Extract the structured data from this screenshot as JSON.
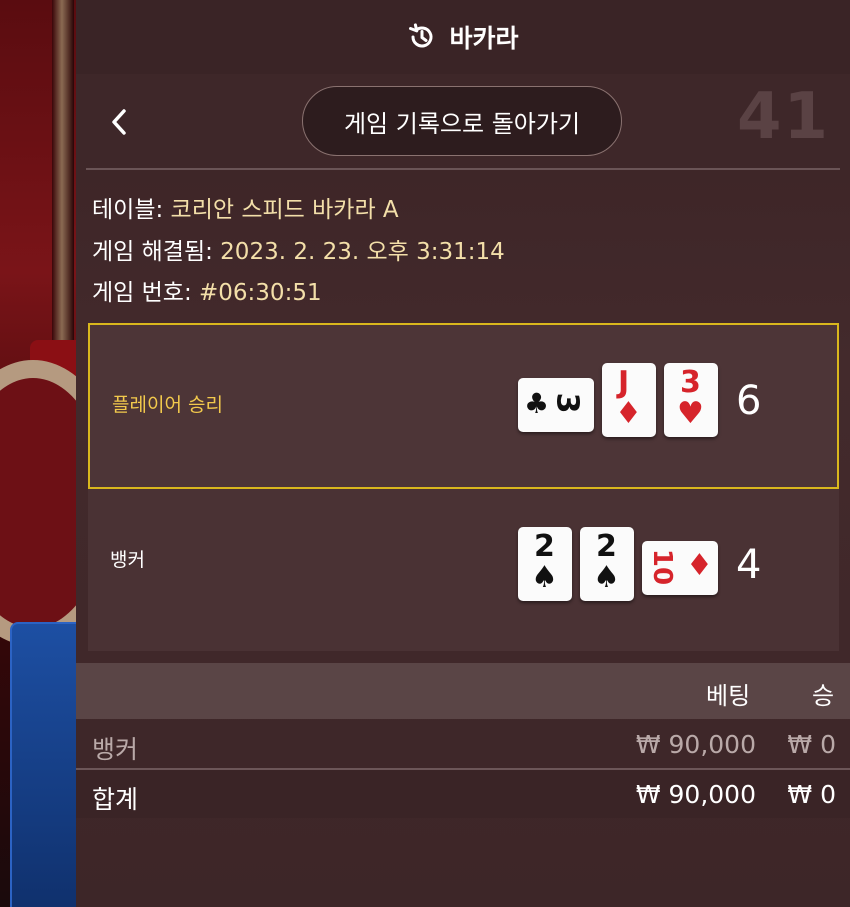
{
  "header": {
    "title": "바카라",
    "icon": "history-icon"
  },
  "nav": {
    "back_button_label": "게임 기록으로 돌아가기",
    "background_number": "41"
  },
  "info": {
    "table_label": "테이블: ",
    "table_value": "코리안 스피드 바카라 A",
    "resolved_label": "게임 해결됨: ",
    "resolved_value": "2023. 2. 23. 오후 3:31:14",
    "game_no_label": "게임 번호: ",
    "game_no_value": "#06:30:51"
  },
  "result": {
    "player": {
      "label": "플레이어 승리",
      "score": "6",
      "cards": [
        {
          "rank": "3",
          "suit": "♣",
          "color": "#111111",
          "orientation": "horizontal"
        },
        {
          "rank": "J",
          "suit": "♦",
          "color": "#d6242b",
          "orientation": "vertical"
        },
        {
          "rank": "3",
          "suit": "♥",
          "color": "#d6242b",
          "orientation": "vertical"
        }
      ]
    },
    "banker": {
      "label": "뱅커",
      "score": "4",
      "cards": [
        {
          "rank": "2",
          "suit": "♠",
          "color": "#111111",
          "orientation": "vertical"
        },
        {
          "rank": "2",
          "suit": "♠",
          "color": "#111111",
          "orientation": "vertical"
        },
        {
          "rank": "10",
          "suit": "♦",
          "color": "#d6242b",
          "orientation": "horizontal"
        }
      ]
    },
    "highlight_color": "#d9b71d"
  },
  "table": {
    "headers": {
      "bet": "베팅",
      "win": "승"
    },
    "rows": [
      {
        "name": "뱅커",
        "bet": "₩ 90,000",
        "win": "₩ 0"
      },
      {
        "name": "합계",
        "bet": "₩ 90,000",
        "win": "₩ 0"
      }
    ]
  }
}
